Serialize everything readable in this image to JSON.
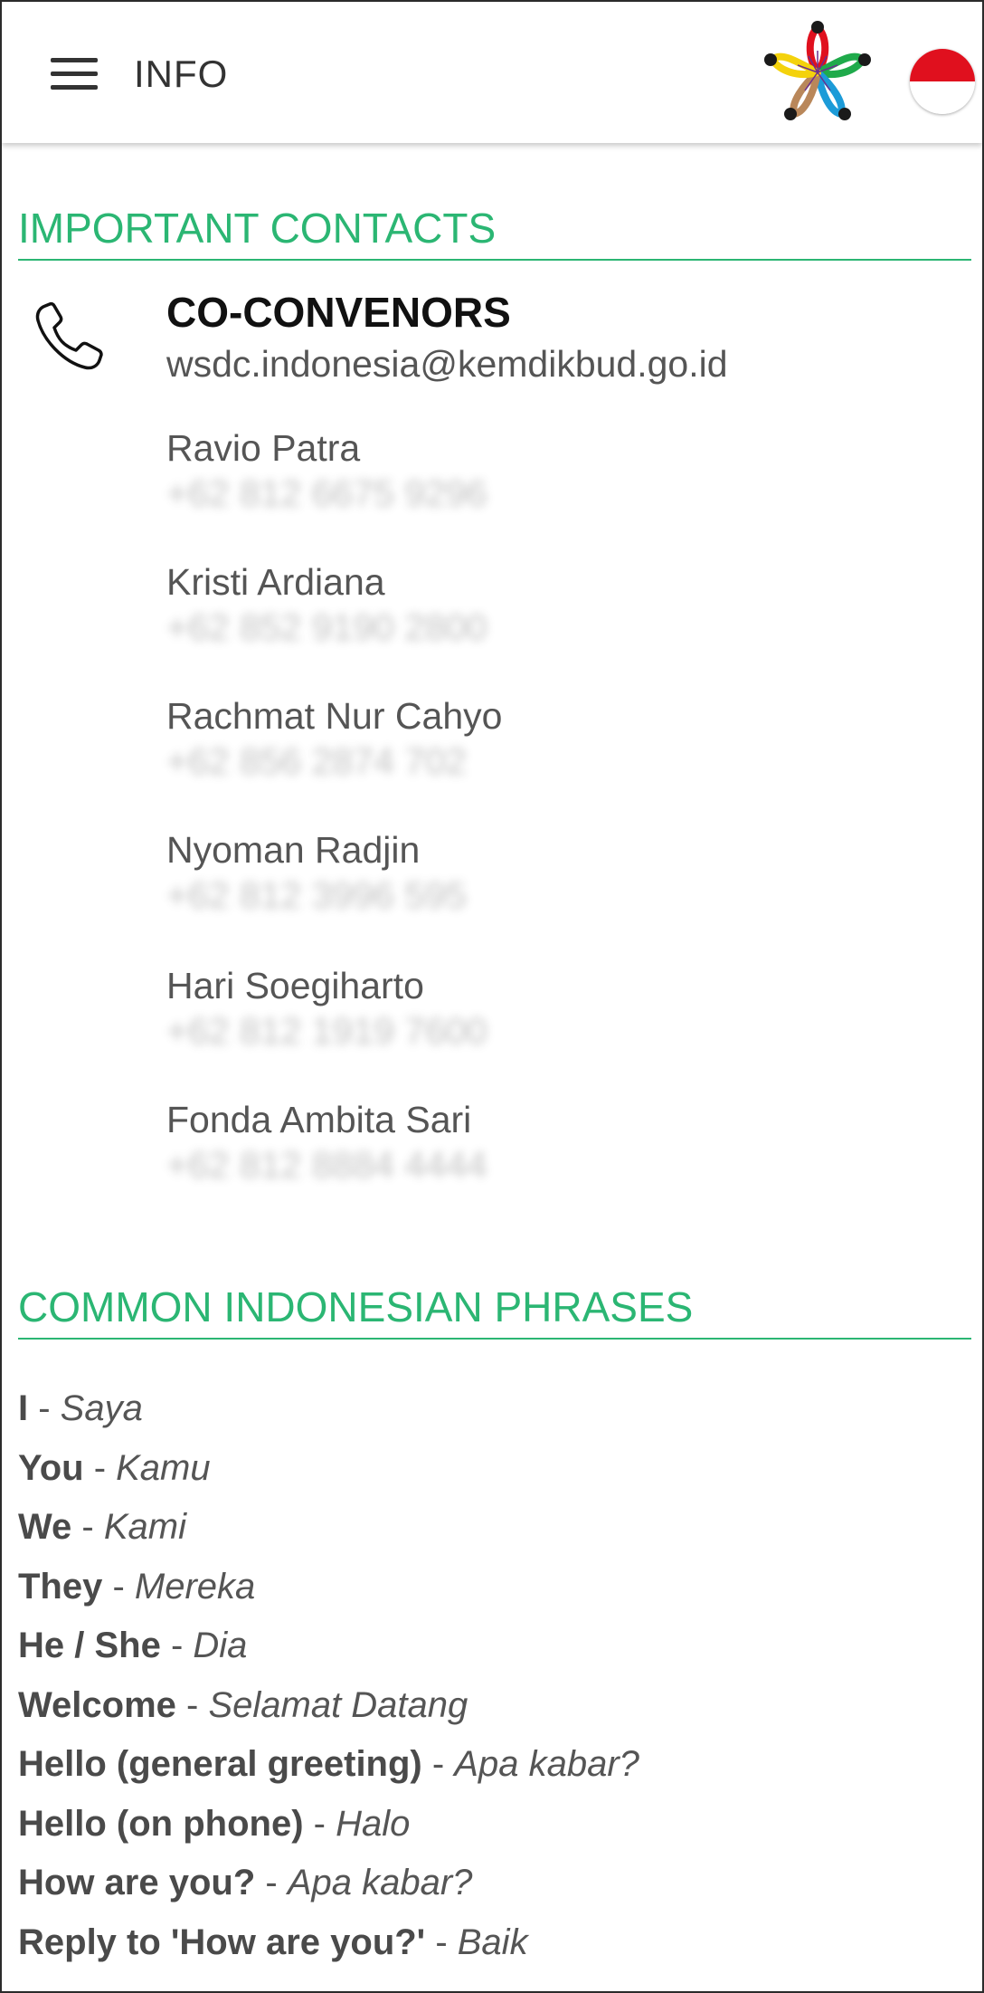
{
  "appbar": {
    "title": "INFO",
    "menu_icon": "hamburger-menu-icon",
    "logo": "wsdc-flower-logo",
    "language_flag": "indonesia-flag"
  },
  "contacts": {
    "section_title": "IMPORTANT CONTACTS",
    "icon": "phone-icon",
    "heading": "CO-CONVENORS",
    "email": "wsdc.indonesia@kemdikbud.go.id",
    "people": [
      {
        "name": "Ravio Patra",
        "phone": "+62 812 6675 9296"
      },
      {
        "name": "Kristi Ardiana",
        "phone": "+62 852 9190 2800"
      },
      {
        "name": "Rachmat Nur Cahyo",
        "phone": "+62 856 2874 702"
      },
      {
        "name": "Nyoman Radjin",
        "phone": "+62 812 3996 595"
      },
      {
        "name": "Hari Soegiharto",
        "phone": "+62 812 1919 7600"
      },
      {
        "name": "Fonda Ambita Sari",
        "phone": "+62 812 8884 4444"
      }
    ]
  },
  "phrases": {
    "section_title": "COMMON INDONESIAN PHRASES",
    "separator": " - ",
    "items": [
      {
        "en": "I",
        "id": "Saya"
      },
      {
        "en": "You",
        "id": "Kamu"
      },
      {
        "en": "We",
        "id": "Kami"
      },
      {
        "en": "They",
        "id": "Mereka"
      },
      {
        "en": "He / She",
        "id": "Dia"
      },
      {
        "en": "Welcome",
        "id": "Selamat Datang"
      },
      {
        "en": "Hello (general greeting)",
        "id": "Apa kabar?"
      },
      {
        "en": "Hello (on phone)",
        "id": "Halo"
      },
      {
        "en": "How are you?",
        "id": "Apa kabar?"
      },
      {
        "en": "Reply to 'How are you?'",
        "id": "Baik"
      }
    ]
  },
  "colors": {
    "accent_green": "#2bb673",
    "flag_red": "#e0101e"
  }
}
